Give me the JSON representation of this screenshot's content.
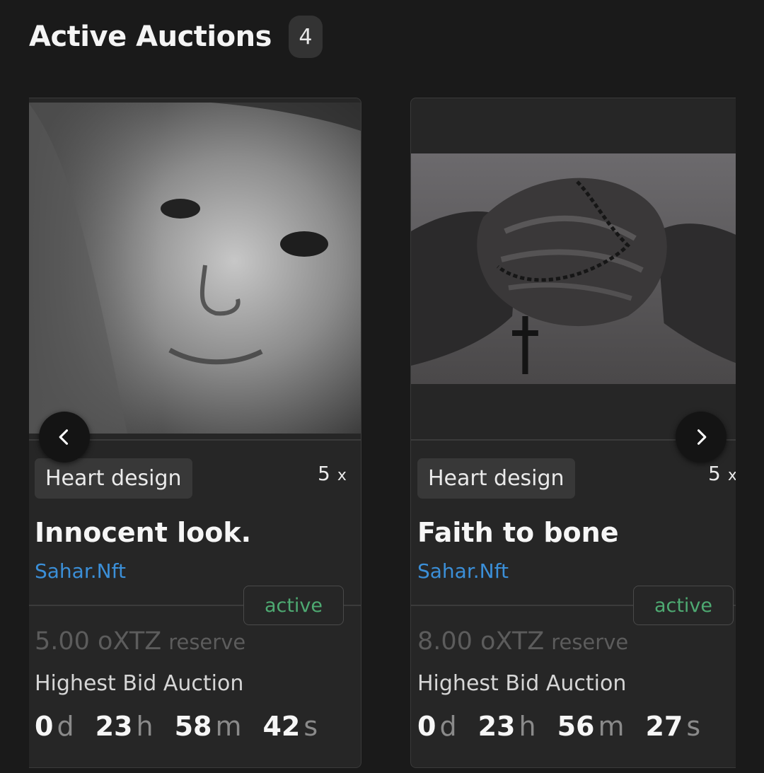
{
  "header": {
    "title": "Active Auctions",
    "count": "4"
  },
  "auctions": [
    {
      "tag": "Heart design",
      "editions": "5",
      "editions_suffix": "x",
      "title": "Innocent look.",
      "creator": "Sahar.Nft",
      "status": "active",
      "reserve_amount": "5.00 oXTZ",
      "reserve_label": "reserve",
      "auction_type": "Highest Bid Auction",
      "countdown": [
        {
          "value": "0",
          "unit": "d"
        },
        {
          "value": "23",
          "unit": "h"
        },
        {
          "value": "58",
          "unit": "m"
        },
        {
          "value": "42",
          "unit": "s"
        }
      ]
    },
    {
      "tag": "Heart design",
      "editions": "5",
      "editions_suffix": "x",
      "title": "Faith to bone",
      "creator": "Sahar.Nft",
      "status": "active",
      "reserve_amount": "8.00 oXTZ",
      "reserve_label": "reserve",
      "auction_type": "Highest Bid Auction",
      "countdown": [
        {
          "value": "0",
          "unit": "d"
        },
        {
          "value": "23",
          "unit": "h"
        },
        {
          "value": "56",
          "unit": "m"
        },
        {
          "value": "27",
          "unit": "s"
        }
      ]
    }
  ],
  "icons": {
    "prev": "chevron-left-icon",
    "next": "chevron-right-icon"
  }
}
